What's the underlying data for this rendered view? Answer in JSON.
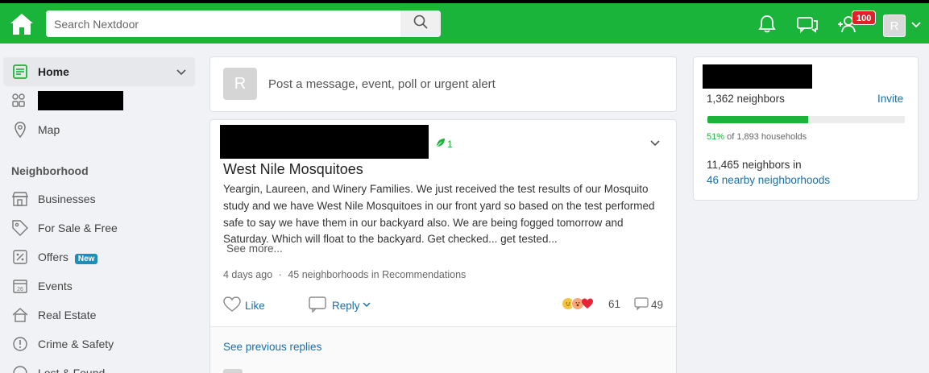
{
  "header": {
    "search_placeholder": "Search Nextdoor",
    "notification_count": "100",
    "avatar_initial": "R",
    "icons": [
      "home-icon",
      "search-icon",
      "bell-icon",
      "chat-icon",
      "people-add-icon",
      "chevron-down-icon"
    ]
  },
  "sidebar": {
    "items": [
      {
        "label": "Home",
        "icon": "home-feed-icon",
        "active": true
      },
      {
        "label": "",
        "icon": "groups-icon",
        "redacted": true
      },
      {
        "label": "Map",
        "icon": "map-pin-icon"
      }
    ],
    "section_title": "Neighborhood",
    "neighborhood_items": [
      {
        "label": "Businesses",
        "icon": "storefront-icon"
      },
      {
        "label": "For Sale & Free",
        "icon": "tag-icon"
      },
      {
        "label": "Offers",
        "icon": "percent-icon",
        "badge": "New"
      },
      {
        "label": "Events",
        "icon": "calendar-icon",
        "day": "26"
      },
      {
        "label": "Real Estate",
        "icon": "house-icon"
      },
      {
        "label": "Crime & Safety",
        "icon": "alert-icon"
      },
      {
        "label": "Lost & Found",
        "icon": "lost-found-icon"
      }
    ]
  },
  "composer": {
    "avatar_initial": "R",
    "prompt": "Post a message, event, poll or urgent alert"
  },
  "post": {
    "leaf_count": "1",
    "title": "West Nile Mosquitoes",
    "body": "Yeargin, Laureen, and Winery Families. We just received the test results of our Mosquito study and we have West Nile Mosquitoes in our front yard so based on the test performed safe to say we have them in our backyard also. We are being fogged tomorrow and Saturday. Which will float to the backyard. Get checked... get tested...",
    "see_more": "See more...",
    "time": "4 days ago",
    "meta_separator": "·",
    "audience": "45 neighborhoods in Recommendations",
    "like_label": "Like",
    "reply_label": "Reply",
    "reaction_count": "61",
    "comment_count": "49",
    "see_previous": "See previous replies"
  },
  "neighborhood_panel": {
    "neighbors": "1,362 neighbors",
    "invite": "Invite",
    "progress_percent": 51,
    "households_pct": "51%",
    "households_text": "of 1,893 households",
    "nearby_count": "11,465 neighbors in",
    "nearby_link": "46 nearby neighborhoods"
  },
  "colors": {
    "brand_green": "#1bb43a",
    "link_blue": "#1a6fa8",
    "badge_red": "#e0202b",
    "new_badge_blue": "#1a8fb8"
  }
}
